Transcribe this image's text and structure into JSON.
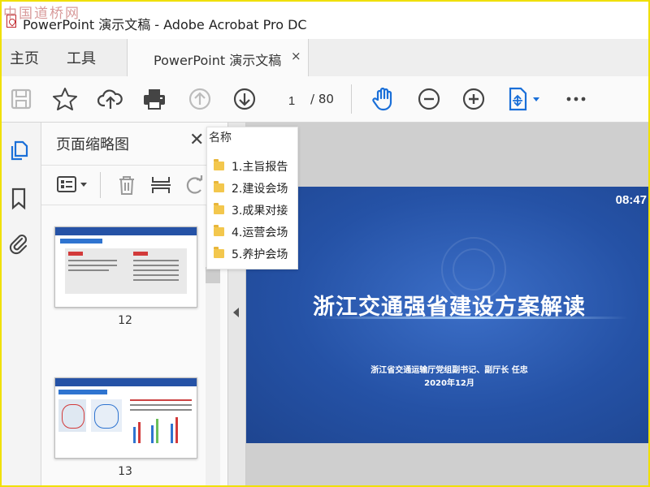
{
  "watermark": "中国道桥网",
  "window": {
    "title": "PowerPoint 演示文稿 - Adobe Acrobat Pro DC"
  },
  "nav": {
    "home": "主页",
    "tools": "工具"
  },
  "doc_tab": {
    "label": "PowerPoint 演示文稿",
    "close": "×"
  },
  "toolbar": {
    "current_page": "1",
    "total_pages": "/ 80",
    "icons": [
      "save-icon",
      "bookmark-star-icon",
      "cloud-upload-icon",
      "print-icon",
      "previous-page-icon",
      "next-page-icon",
      "hand-tool-icon",
      "zoom-out-icon",
      "zoom-in-icon",
      "fit-page-icon",
      "more-icon"
    ]
  },
  "rail": {
    "icons": [
      "page-thumbnails-icon",
      "bookmarks-icon",
      "attachments-icon"
    ]
  },
  "thumbnail_panel": {
    "title": "页面缩略图",
    "close": "✕",
    "thumbnails": [
      {
        "label": "12"
      },
      {
        "label": "13"
      }
    ]
  },
  "folder_popup": {
    "header": "名称",
    "items": [
      {
        "label": "1.主旨报告"
      },
      {
        "label": "2.建设会场"
      },
      {
        "label": "3.成果对接"
      },
      {
        "label": "4.运营会场"
      },
      {
        "label": "5.养护会场"
      }
    ]
  },
  "slide": {
    "time": "08:47",
    "title": "浙江交通强省建设方案解读",
    "subtitle": "浙江省交通运输厅党组副书记、副厅长  任忠",
    "date": "2020年12月"
  },
  "colors": {
    "frame": "#f0e000",
    "slide_blue": "#2552a6",
    "accent_blue": "#1a73e8",
    "folder": "#f3c74d"
  }
}
